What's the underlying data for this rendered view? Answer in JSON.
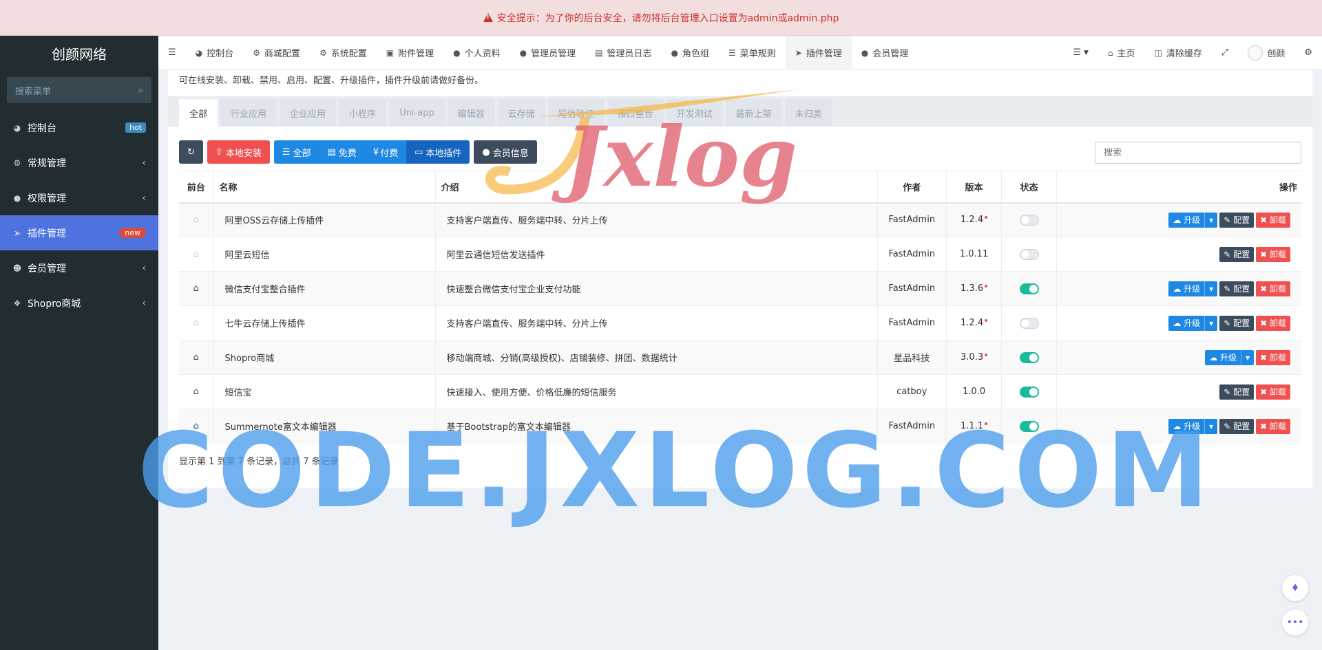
{
  "alert": {
    "text": "安全提示：为了你的后台安全，请勿将后台管理入口设置为admin或admin.php"
  },
  "sidebar": {
    "logo": "创颜网络",
    "search_placeholder": "搜索菜单",
    "items": [
      {
        "label": "控制台",
        "icon": "dashboard-icon",
        "badge": "hot"
      },
      {
        "label": "常规管理",
        "icon": "cogs-icon"
      },
      {
        "label": "权限管理",
        "icon": "group-icon"
      },
      {
        "label": "插件管理",
        "icon": "rocket-icon",
        "badge": "new",
        "active": true
      },
      {
        "label": "会员管理",
        "icon": "user-circle-icon"
      },
      {
        "label": "Shopro商城",
        "icon": "dropbox-icon"
      }
    ]
  },
  "topnav": {
    "items": [
      "控制台",
      "商城配置",
      "系统配置",
      "附件管理",
      "个人资料",
      "管理员管理",
      "管理员日志",
      "角色组",
      "菜单规则",
      "插件管理",
      "会员管理"
    ],
    "active": "插件管理",
    "right": {
      "home": "主页",
      "clear_cache": "清除缓存",
      "user": "创颜"
    }
  },
  "content": {
    "subtitle": "可在线安装、卸载、禁用、启用、配置、升级插件，插件升级前请做好备份。",
    "tabs": [
      "全部",
      "行业应用",
      "企业应用",
      "小程序",
      "Uni-app",
      "编辑器",
      "云存储",
      "短信验证",
      "接口整合",
      "开发测试",
      "最新上架",
      "未归类"
    ],
    "toolbar": {
      "local_install": "本地安装",
      "filters": [
        "全部",
        "免费",
        "付费",
        "本地插件"
      ],
      "member_info": "会员信息",
      "search_placeholder": "搜索"
    },
    "table": {
      "headers": {
        "front": "前台",
        "name": "名称",
        "intro": "介绍",
        "author": "作者",
        "version": "版本",
        "status": "状态",
        "ops": "操作"
      },
      "rows": [
        {
          "name": "阿里OSS云存储上传插件",
          "intro": "支持客户端直传、服务端中转、分片上传",
          "author": "FastAdmin",
          "version": "1.2.4",
          "update": true,
          "enabled": false,
          "front": false,
          "upgrade": true,
          "config": true
        },
        {
          "name": "阿里云短信",
          "intro": "阿里云通信短信发送插件",
          "author": "FastAdmin",
          "version": "1.0.11",
          "update": false,
          "enabled": false,
          "front": false,
          "upgrade": false,
          "config": true
        },
        {
          "name": "微信支付宝整合插件",
          "intro": "快速整合微信支付宝企业支付功能",
          "author": "FastAdmin",
          "version": "1.3.6",
          "update": true,
          "enabled": true,
          "front": true,
          "upgrade": true,
          "config": true
        },
        {
          "name": "七牛云存储上传插件",
          "intro": "支持客户端直传、服务端中转、分片上传",
          "author": "FastAdmin",
          "version": "1.2.4",
          "update": true,
          "enabled": false,
          "front": false,
          "upgrade": true,
          "config": true
        },
        {
          "name": "Shopro商城",
          "intro": "移动端商城、分销(高级授权)、店铺装修、拼团、数据统计",
          "author": "星品科技",
          "version": "3.0.3",
          "update": true,
          "enabled": true,
          "front": true,
          "upgrade": true,
          "config": false
        },
        {
          "name": "短信宝",
          "intro": "快速接入、使用方便、价格低廉的短信服务",
          "author": "catboy",
          "version": "1.0.0",
          "update": false,
          "enabled": true,
          "front": true,
          "upgrade": false,
          "config": true
        },
        {
          "name": "Summernote富文本编辑器",
          "intro": "基于Bootstrap的富文本编辑器",
          "author": "FastAdmin",
          "version": "1.1.1",
          "update": true,
          "enabled": true,
          "front": true,
          "upgrade": true,
          "config": true
        }
      ],
      "actions": {
        "upgrade": "升级",
        "config": "配置",
        "uninstall": "卸载"
      }
    },
    "pagination": "显示第 1 到第 7 条记录，总共 7 条记录"
  },
  "watermarks": {
    "top": "Jxlog",
    "bottom": "CODE.JXLOG.COM"
  },
  "colors": {
    "sidebar_bg": "#222d32",
    "active_menu": "#4e73df",
    "primary": "#1e88e5",
    "danger": "#f05050",
    "dark": "#3c4c5d",
    "success": "#18bc9c"
  }
}
